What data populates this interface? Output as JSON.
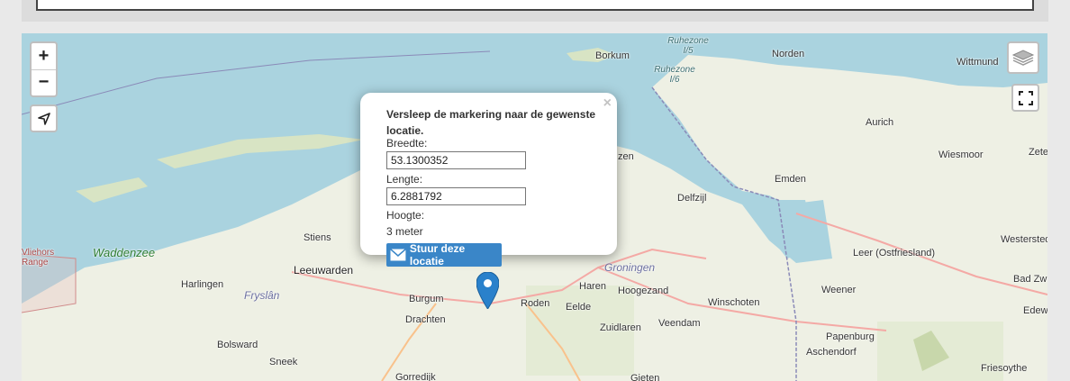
{
  "map": {
    "zoom_in": "+",
    "zoom_out": "−",
    "places": [
      {
        "name": "Borkum",
        "cls": "place"
      },
      {
        "name": "Norden",
        "cls": "place"
      },
      {
        "name": "Wittmund",
        "cls": "place"
      },
      {
        "name": "Aurich",
        "cls": "place"
      },
      {
        "name": "Wiesmoor",
        "cls": "place"
      },
      {
        "name": "Zete",
        "cls": "place"
      },
      {
        "name": "Emden",
        "cls": "place"
      },
      {
        "name": "Delfzijl",
        "cls": "place"
      },
      {
        "name": "zen",
        "cls": "place"
      },
      {
        "name": "Leer (Ostfriesland)",
        "cls": "place"
      },
      {
        "name": "Westersted",
        "cls": "place"
      },
      {
        "name": "Stiens",
        "cls": "place"
      },
      {
        "name": "Leeuwarden",
        "cls": "place big"
      },
      {
        "name": "Harlingen",
        "cls": "place"
      },
      {
        "name": "Burgum",
        "cls": "place"
      },
      {
        "name": "Drachten",
        "cls": "place"
      },
      {
        "name": "Roden",
        "cls": "place"
      },
      {
        "name": "Eelde",
        "cls": "place"
      },
      {
        "name": "Haren",
        "cls": "place"
      },
      {
        "name": "Hoogezand",
        "cls": "place"
      },
      {
        "name": "Winschoten",
        "cls": "place"
      },
      {
        "name": "Weener",
        "cls": "place"
      },
      {
        "name": "Bad Zwis",
        "cls": "place"
      },
      {
        "name": "Edewe",
        "cls": "place"
      },
      {
        "name": "Zuidlaren",
        "cls": "place"
      },
      {
        "name": "Veendam",
        "cls": "place"
      },
      {
        "name": "Papenburg",
        "cls": "place"
      },
      {
        "name": "Aschendorf",
        "cls": "place"
      },
      {
        "name": "Friesoythe",
        "cls": "place"
      },
      {
        "name": "Bolsward",
        "cls": "place"
      },
      {
        "name": "Sneek",
        "cls": "place"
      },
      {
        "name": "Gorredijk",
        "cls": "place"
      },
      {
        "name": "Gieten",
        "cls": "place"
      },
      {
        "name": "Fryslân",
        "cls": "place region"
      },
      {
        "name": "Groningen",
        "cls": "place region"
      },
      {
        "name": "Waddenzee",
        "cls": "place green"
      },
      {
        "name": "Ruhezone I/5",
        "cls": "place ruhe"
      },
      {
        "name": "Ruhezone I/6",
        "cls": "place ruhe"
      },
      {
        "name": "Vliehors Range",
        "cls": "place red"
      }
    ]
  },
  "popup": {
    "close": "×",
    "title": "Versleep de markering naar de gewenste locatie.",
    "lat_label": "Breedte:",
    "lat_value": "53.1300352",
    "lon_label": "Lengte:",
    "lon_value": "6.2881792",
    "alt_label": "Hoogte:",
    "alt_value": "3 meter",
    "send_label": "Stuur deze locatie"
  },
  "colors": {
    "water": "#aad3df",
    "land": "#eef0e4",
    "button": "#3a86c8",
    "marker": "#2a81cb"
  }
}
